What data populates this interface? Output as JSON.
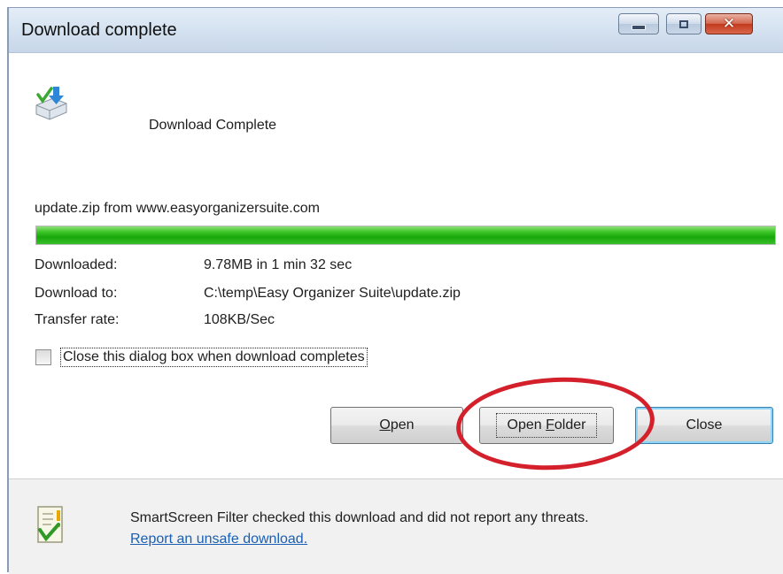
{
  "window": {
    "title": "Download complete",
    "controls": [
      "minimize-icon",
      "maximize-icon",
      "close-icon"
    ]
  },
  "header": {
    "icon": "download-complete-icon",
    "text": "Download Complete"
  },
  "download": {
    "source": "update.zip from www.easyorganizersuite.com",
    "progress_percent": 100,
    "progress_color": "#2fc01f"
  },
  "details": [
    {
      "label": "Downloaded:",
      "value": "9.78MB in 1 min 32 sec"
    },
    {
      "label": "Download to:",
      "value": "C:\\temp\\Easy Organizer Suite\\update.zip"
    },
    {
      "label": "Transfer rate:",
      "value": "108KB/Sec"
    }
  ],
  "option": {
    "checkbox_label": "Close this dialog box when download completes",
    "checked": false
  },
  "buttons": {
    "open_label": "Open",
    "open_folder_label": "Open Folder",
    "close_label": "Close"
  },
  "annotation": {
    "highlight_color": "#d4202b",
    "highlighted": "Open Folder"
  },
  "footer": {
    "icon": "smartscreen-shield-icon",
    "message": "SmartScreen Filter checked this download and did not report any threats.",
    "link_text": "Report an unsafe download."
  }
}
